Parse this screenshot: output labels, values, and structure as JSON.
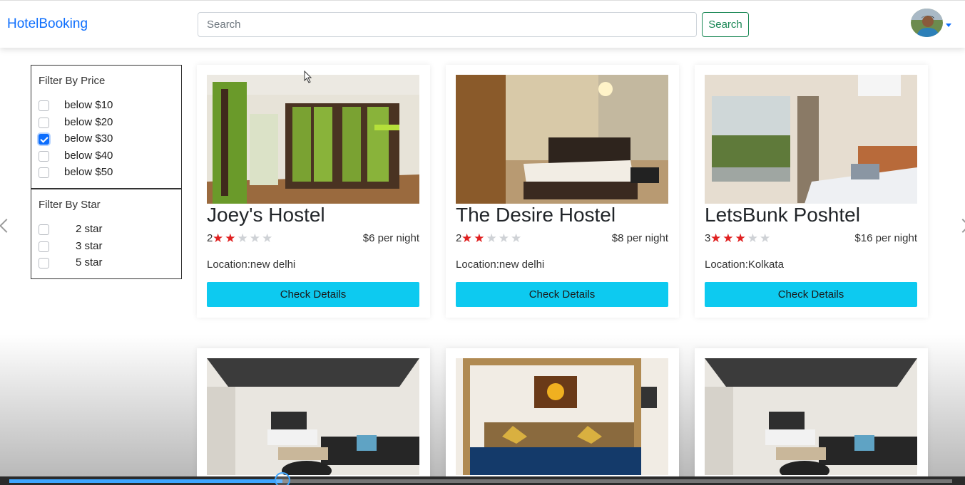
{
  "navbar": {
    "brand": "HotelBooking",
    "search_placeholder": "Search",
    "search_button": "Search"
  },
  "filters": {
    "price": {
      "title": "Filter By Price",
      "options": [
        {
          "label": "below $10",
          "checked": false
        },
        {
          "label": "below $20",
          "checked": false
        },
        {
          "label": "below $30",
          "checked": true
        },
        {
          "label": "below $40",
          "checked": false
        },
        {
          "label": "below $50",
          "checked": false
        }
      ]
    },
    "star": {
      "title": "Filter By Star",
      "options": [
        {
          "label": "2 star",
          "checked": false
        },
        {
          "label": "3 star",
          "checked": false
        },
        {
          "label": "5 star",
          "checked": false
        }
      ]
    }
  },
  "hotels": [
    {
      "name": "Joey's Hostel",
      "stars": 2,
      "max_stars": 5,
      "price": "$6 per night",
      "location": "Location:new delhi",
      "button": "Check Details"
    },
    {
      "name": "The Desire Hostel",
      "stars": 2,
      "max_stars": 5,
      "price": "$8 per night",
      "location": "Location:new delhi",
      "button": "Check Details"
    },
    {
      "name": "LetsBunk Poshtel",
      "stars": 3,
      "max_stars": 5,
      "price": "$16 per night",
      "location": "Location:Kolkata",
      "button": "Check Details"
    }
  ],
  "video_progress": 0.29,
  "colors": {
    "brand": "#0d6efd",
    "search_button": "#198754",
    "details_button": "#0dcaf0",
    "star_on": "#e02020",
    "progress": "#3ea6ff"
  }
}
